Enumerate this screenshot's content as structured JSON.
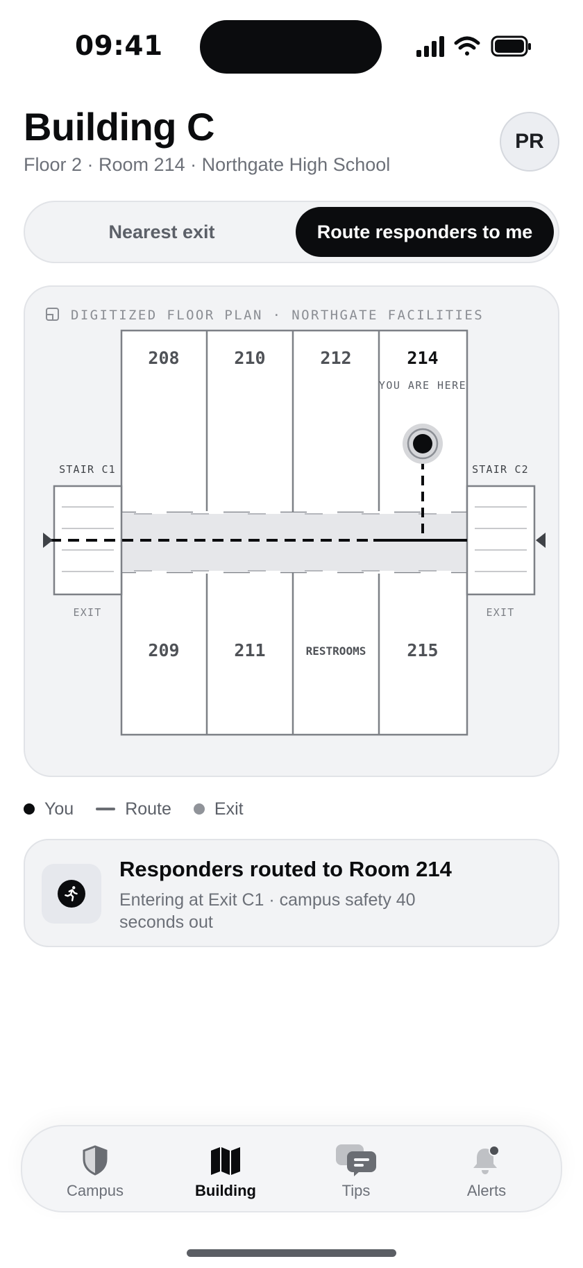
{
  "status_bar": {
    "time": "09:41"
  },
  "header": {
    "title": "Building C",
    "subtitle": "Floor 2 · Room 214 · Northgate High School",
    "avatar_initials": "PR"
  },
  "segmented": {
    "options": [
      "Nearest exit",
      "Route responders to me"
    ],
    "selected": "Route responders to me"
  },
  "floor_plan": {
    "source_label": "DIGITIZED FLOOR PLAN · NORTHGATE FACILITIES",
    "top_rooms": [
      "208",
      "210",
      "212",
      "214"
    ],
    "bottom_rooms": [
      "209",
      "211",
      "RESTROOMS",
      "215"
    ],
    "you_are_here": "YOU ARE HERE",
    "stair_left": "STAIR C1",
    "stair_right": "STAIR C2",
    "exit_left": "EXIT",
    "exit_right": "EXIT",
    "current_room": "214"
  },
  "legend": {
    "you": "You",
    "route": "Route",
    "exit": "Exit"
  },
  "route_card": {
    "title": "Responders routed to Room 214",
    "detail": "Entering at Exit C1 · campus safety 40 seconds out"
  },
  "tabs": [
    {
      "label": "Campus",
      "icon": "shield-icon"
    },
    {
      "label": "Building",
      "icon": "map-icon"
    },
    {
      "label": "Tips",
      "icon": "chat-icon"
    },
    {
      "label": "Alerts",
      "icon": "bell-icon"
    }
  ],
  "active_tab": "Building",
  "colors": {
    "accent": "#0b0c0e",
    "surface": "#f2f3f5",
    "muted_text": "#6c7078"
  }
}
